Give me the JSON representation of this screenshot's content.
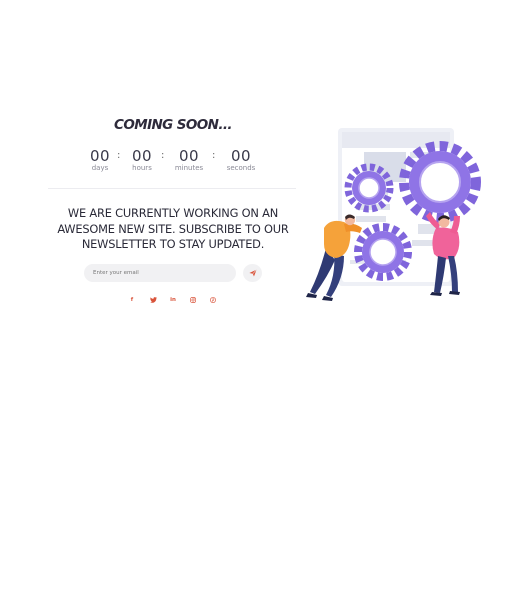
{
  "heading": "COMING SOON...",
  "countdown": {
    "days": {
      "value": "00",
      "label": "days"
    },
    "hours": {
      "value": "00",
      "label": "hours"
    },
    "minutes": {
      "value": "00",
      "label": "minutes"
    },
    "seconds": {
      "value": "00",
      "label": "seconds"
    },
    "separator": ":"
  },
  "message": {
    "line1": "WE ARE CURRENTLY WORKING ON AN",
    "line2": "AWESOME NEW SITE. SUBSCRIBE TO OUR",
    "line3": "NEWSLETTER TO STAY UPDATED."
  },
  "subscribe": {
    "placeholder": "Enter your email",
    "send_icon": "paper-plane-icon"
  },
  "social": {
    "facebook": {
      "icon": "facebook-icon",
      "glyph": "f"
    },
    "twitter": {
      "icon": "twitter-icon"
    },
    "linkedin": {
      "icon": "linkedin-icon",
      "glyph": "in"
    },
    "instagram": {
      "icon": "instagram-icon"
    },
    "pinterest": {
      "icon": "pinterest-icon"
    }
  },
  "colors": {
    "accent": "#d9533a",
    "heading": "#2e2b3b",
    "gear": "#8f74e6",
    "person_pink": "#f0639a",
    "person_orange": "#f5a23a"
  }
}
